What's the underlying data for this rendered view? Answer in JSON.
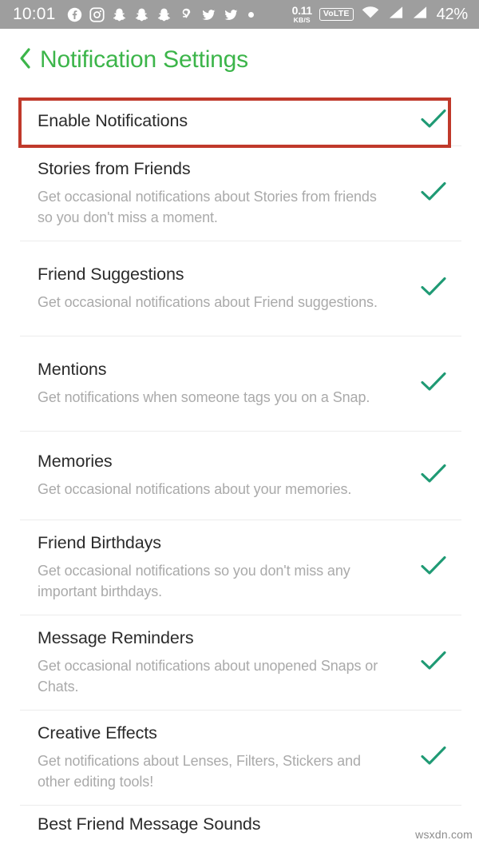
{
  "statusbar": {
    "clock": "10:01",
    "icons": [
      {
        "name": "facebook-icon"
      },
      {
        "name": "instagram-icon"
      },
      {
        "name": "snapchat-icon"
      },
      {
        "name": "snapchat-icon"
      },
      {
        "name": "snapchat-icon"
      },
      {
        "name": "swiggy-icon"
      },
      {
        "name": "twitter-icon"
      },
      {
        "name": "twitter-icon"
      },
      {
        "name": "more-dot-icon"
      }
    ],
    "datarate_value": "0.11",
    "datarate_unit": "KB/S",
    "volte_label": "VoLTE",
    "wifi_icon": "wifi-icon",
    "signal_one_icon": "signal-bars-icon",
    "signal_two_icon": "signal-bars-icon",
    "battery": "42%"
  },
  "header": {
    "back_icon": "chevron-left-icon",
    "title": "Notification Settings",
    "title_color": "#3cb54a"
  },
  "theme": {
    "check_color": "#1f9a74",
    "highlight_color": "#c0392b",
    "divider_color": "#ececec",
    "title_text_color": "#2b2b2b",
    "desc_text_color": "#aaaaaa"
  },
  "settings": [
    {
      "title": "Enable Notifications",
      "desc": "",
      "checked": true,
      "highlighted": true
    },
    {
      "title": "Stories from Friends",
      "desc": "Get occasional notifications about Stories from friends so you don't miss a moment.",
      "checked": true,
      "highlighted": false
    },
    {
      "title": "Friend Suggestions",
      "desc": "Get occasional notifications about Friend suggestions.",
      "checked": true,
      "highlighted": false
    },
    {
      "title": "Mentions",
      "desc": "Get notifications when someone tags you on a Snap.",
      "checked": true,
      "highlighted": false
    },
    {
      "title": "Memories",
      "desc": "Get occasional notifications about your memories.",
      "checked": true,
      "highlighted": false
    },
    {
      "title": "Friend Birthdays",
      "desc": "Get occasional notifications so you don't miss any important birthdays.",
      "checked": true,
      "highlighted": false
    },
    {
      "title": "Message Reminders",
      "desc": "Get occasional notifications about unopened Snaps or Chats.",
      "checked": true,
      "highlighted": false
    },
    {
      "title": "Creative Effects",
      "desc": "Get notifications about Lenses, Filters, Stickers and other editing tools!",
      "checked": true,
      "highlighted": false
    },
    {
      "title": "Best Friend Message Sounds",
      "desc": "",
      "checked": false,
      "highlighted": false
    }
  ],
  "watermark": "wsxdn.com"
}
